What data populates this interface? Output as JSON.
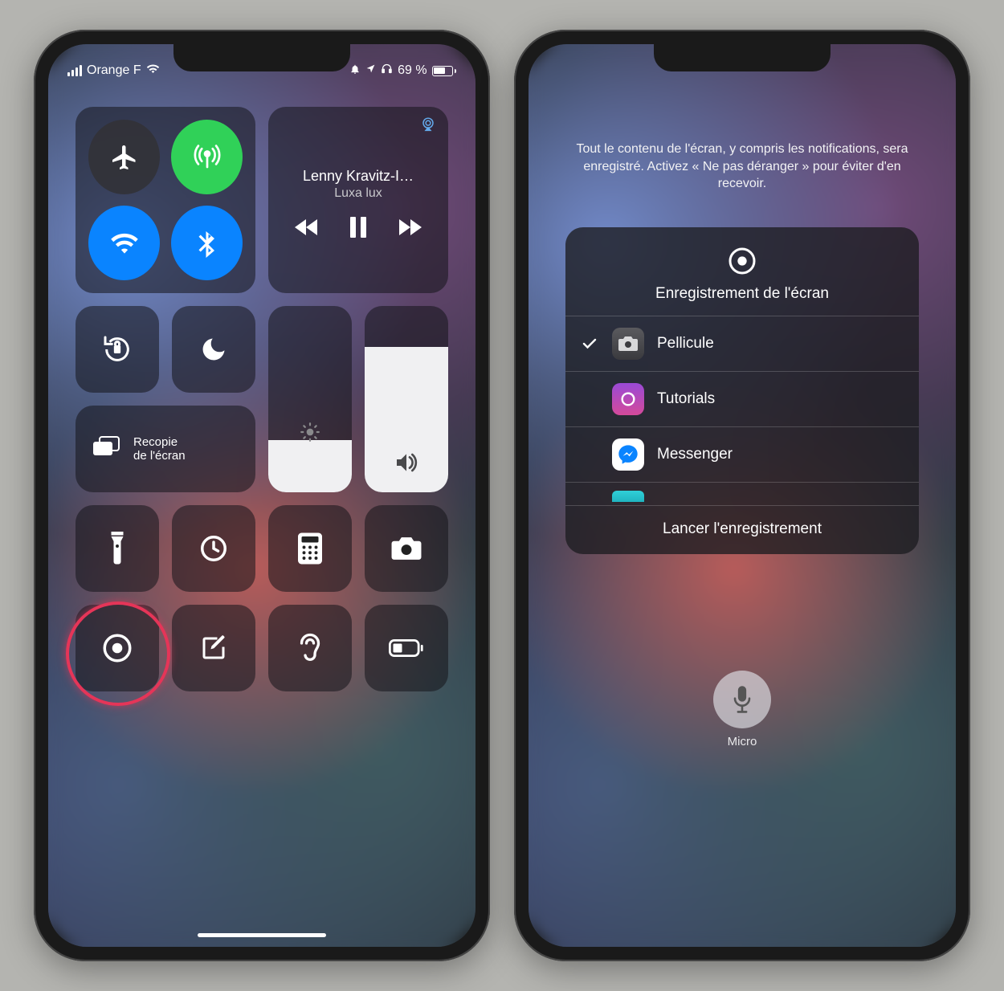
{
  "left": {
    "status": {
      "carrier": "Orange F",
      "battery_pct": "69 %"
    },
    "connectivity": {
      "airplane": "airplane-icon",
      "cellular": "cellular-data-icon",
      "wifi": "wifi-icon",
      "bluetooth": "bluetooth-icon"
    },
    "media": {
      "title": "Lenny Kravitz-I…",
      "subtitle": "Luxa lux",
      "airplay": "airplay-icon"
    },
    "rotation_lock": "rotation-lock-icon",
    "dnd": "do-not-disturb-icon",
    "mirror": {
      "label": "Recopie\nde l'écran"
    },
    "brightness_icon": "brightness-icon",
    "volume_icon": "volume-icon",
    "quick": {
      "flashlight": "flashlight-icon",
      "timer": "timer-icon",
      "calculator": "calculator-icon",
      "camera": "camera-icon",
      "record": "screen-record-icon",
      "notes": "compose-icon",
      "hearing": "hearing-icon",
      "lowpower": "low-power-icon"
    }
  },
  "right": {
    "message": "Tout le contenu de l'écran, y compris les notifications, sera enregistré. Activez « Ne pas déranger » pour éviter d'en recevoir.",
    "panel_title": "Enregistrement de l'écran",
    "destinations": [
      {
        "selected": true,
        "label": "Pellicule",
        "icon": "photos-icon"
      },
      {
        "selected": false,
        "label": "Tutorials",
        "icon": "tutorials-app-icon"
      },
      {
        "selected": false,
        "label": "Messenger",
        "icon": "messenger-app-icon"
      }
    ],
    "start_label": "Lancer l'enregistrement",
    "mic_label": "Micro"
  }
}
